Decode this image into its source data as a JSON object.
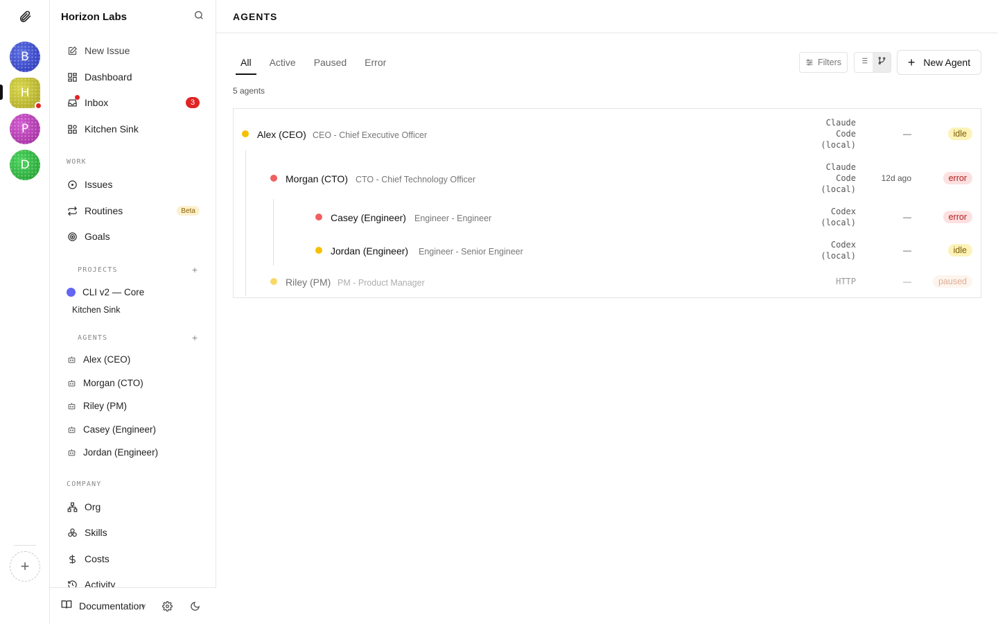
{
  "workspaces": [
    {
      "letter": "B"
    },
    {
      "letter": "H",
      "active": true,
      "notify": true
    },
    {
      "letter": "P"
    },
    {
      "letter": "D"
    }
  ],
  "sidebar": {
    "company": "Horizon Labs",
    "top_items": [
      {
        "label": "New Issue",
        "icon": "pencil-square-icon"
      },
      {
        "label": "Dashboard",
        "icon": "grid-icon"
      },
      {
        "label": "Inbox",
        "icon": "inbox-icon",
        "badge": "3"
      },
      {
        "label": "Kitchen Sink",
        "icon": "kitchen-sink-icon"
      }
    ],
    "work_label": "WORK",
    "work_items": [
      {
        "label": "Issues",
        "icon": "circle-dot-icon"
      },
      {
        "label": "Routines",
        "icon": "repeat-icon",
        "badge": "Beta"
      },
      {
        "label": "Goals",
        "icon": "target-icon"
      }
    ],
    "projects_label": "PROJECTS",
    "projects": [
      {
        "label": "CLI v2 — Core",
        "color": "#6366f1"
      },
      {
        "label": "Kitchen Sink"
      }
    ],
    "agents_label": "AGENTS",
    "agents": [
      "Alex (CEO)",
      "Morgan (CTO)",
      "Riley (PM)",
      "Casey (Engineer)",
      "Jordan (Engineer)"
    ],
    "company_label": "COMPANY",
    "company_items": [
      {
        "label": "Org",
        "icon": "org-chart-icon"
      },
      {
        "label": "Skills",
        "icon": "skills-icon"
      },
      {
        "label": "Costs",
        "icon": "dollar-icon"
      },
      {
        "label": "Activity",
        "icon": "history-icon"
      }
    ],
    "footer": {
      "docs": "Documentation",
      "version": "v"
    }
  },
  "main": {
    "title": "AGENTS",
    "tabs": [
      "All",
      "Active",
      "Paused",
      "Error"
    ],
    "active_tab": "All",
    "count_text": "5 agents",
    "filters_label": "Filters",
    "new_agent_label": "New Agent",
    "agents": [
      {
        "name": "Alex (CEO)",
        "role": "CEO - Chief Executive Officer",
        "adapter": "Claude\nCode\n(local)",
        "last": "—",
        "status": "idle",
        "dot": "#f5c000"
      },
      {
        "name": "Morgan (CTO)",
        "role": "CTO - Chief Technology Officer",
        "adapter": "Claude\nCode\n(local)",
        "last": "12d ago",
        "status": "error",
        "dot": "#f06060"
      },
      {
        "name": "Casey (Engineer)",
        "role": "Engineer - Engineer",
        "adapter": "Codex\n(local)",
        "last": "—",
        "status": "error",
        "dot": "#f06060"
      },
      {
        "name": "Jordan (Engineer)",
        "role": "Engineer - Senior Engineer",
        "adapter": "Codex\n(local)",
        "last": "—",
        "status": "idle",
        "dot": "#f5c000"
      },
      {
        "name": "Riley (PM)",
        "role": "PM - Product Manager",
        "adapter": "HTTP",
        "last": "—",
        "status": "paused",
        "dot": "#f5c000"
      }
    ]
  }
}
